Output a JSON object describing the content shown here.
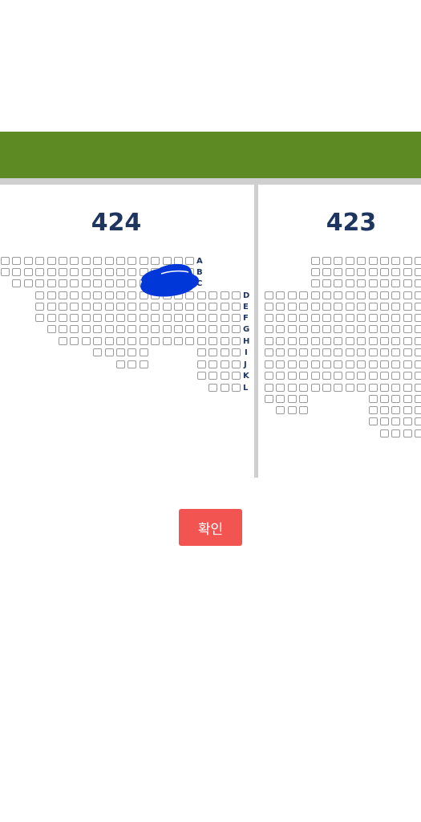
{
  "stadium": {
    "field_color": "#5e8a24",
    "seat_border_color": "#9a9a9a",
    "label_color": "#1e3560"
  },
  "sections": [
    {
      "name": "424",
      "row_labels": [
        "A",
        "B",
        "C",
        "D",
        "E",
        "F",
        "G",
        "H",
        "I",
        "J",
        "K",
        "L"
      ]
    },
    {
      "name": "423"
    }
  ],
  "annotation": {
    "color": "#0037d9",
    "description": "scribble-mark"
  },
  "confirm_button": {
    "label": "확인",
    "color": "#f25452"
  }
}
